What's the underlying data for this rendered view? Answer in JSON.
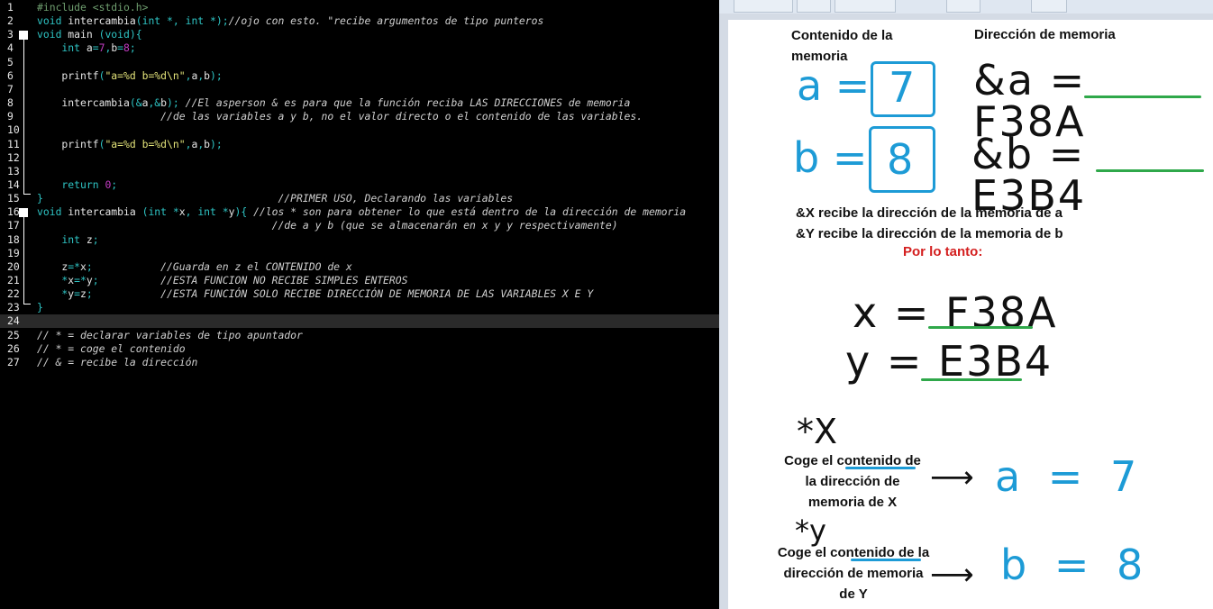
{
  "editor": {
    "lines": [
      {
        "n": "1",
        "tokens": [
          [
            "pp",
            "#include <stdio.h>"
          ]
        ]
      },
      {
        "n": "2",
        "tokens": [
          [
            "kw",
            "void "
          ],
          [
            "id",
            "intercambia"
          ],
          [
            "kw",
            "(int *, int *);"
          ],
          [
            "cm",
            "//ojo con esto. \"recibe argumentos de tipo punteros"
          ]
        ]
      },
      {
        "n": "3",
        "tokens": [
          [
            "kw",
            "void "
          ],
          [
            "id",
            "main "
          ],
          [
            "kw",
            "(void){"
          ]
        ]
      },
      {
        "n": "4",
        "tokens": [
          [
            "kw",
            "    int "
          ],
          [
            "id",
            "a"
          ],
          [
            "kw",
            "="
          ],
          [
            "num",
            "7"
          ],
          [
            "kw",
            ","
          ],
          [
            "id",
            "b"
          ],
          [
            "kw",
            "="
          ],
          [
            "num",
            "8"
          ],
          [
            "kw",
            ";"
          ]
        ]
      },
      {
        "n": "5",
        "tokens": []
      },
      {
        "n": "6",
        "tokens": [
          [
            "id",
            "    printf"
          ],
          [
            "kw",
            "("
          ],
          [
            "str",
            "\"a=%d b=%d\\n\""
          ],
          [
            "kw",
            ","
          ],
          [
            "id",
            "a"
          ],
          [
            "kw",
            ","
          ],
          [
            "id",
            "b"
          ],
          [
            "kw",
            ");"
          ]
        ]
      },
      {
        "n": "7",
        "tokens": []
      },
      {
        "n": "8",
        "tokens": [
          [
            "id",
            "    intercambia"
          ],
          [
            "kw",
            "(&"
          ],
          [
            "id",
            "a"
          ],
          [
            "kw",
            ",&"
          ],
          [
            "id",
            "b"
          ],
          [
            "kw",
            "); "
          ],
          [
            "cm",
            "//El asperson & es para que la función reciba LAS DIRECCIONES de memoria"
          ]
        ]
      },
      {
        "n": "9",
        "tokens": [
          [
            "cm",
            "                    //de las variables a y b, no el valor directo o el contenido de las variables."
          ]
        ]
      },
      {
        "n": "10",
        "tokens": []
      },
      {
        "n": "11",
        "tokens": [
          [
            "id",
            "    printf"
          ],
          [
            "kw",
            "("
          ],
          [
            "str",
            "\"a=%d b=%d\\n\""
          ],
          [
            "kw",
            ","
          ],
          [
            "id",
            "a"
          ],
          [
            "kw",
            ","
          ],
          [
            "id",
            "b"
          ],
          [
            "kw",
            ");"
          ]
        ]
      },
      {
        "n": "12",
        "tokens": []
      },
      {
        "n": "13",
        "tokens": []
      },
      {
        "n": "14",
        "tokens": [
          [
            "kw",
            "    return "
          ],
          [
            "num",
            "0"
          ],
          [
            "kw",
            ";"
          ]
        ]
      },
      {
        "n": "15",
        "tokens": [
          [
            "kw",
            "}"
          ],
          [
            "cm",
            "                                      //PRIMER USO, Declarando las variables"
          ]
        ]
      },
      {
        "n": "16",
        "tokens": [
          [
            "kw",
            "void "
          ],
          [
            "id",
            "intercambia "
          ],
          [
            "kw",
            "(int *"
          ],
          [
            "id",
            "x"
          ],
          [
            "kw",
            ", int *"
          ],
          [
            "id",
            "y"
          ],
          [
            "kw",
            "){ "
          ],
          [
            "cm",
            "//los * son para obtener lo que está dentro de la dirección de memoria"
          ]
        ]
      },
      {
        "n": "17",
        "tokens": [
          [
            "cm",
            "                                      //de a y b (que se almacenarán en x y y respectivamente)"
          ]
        ]
      },
      {
        "n": "18",
        "tokens": [
          [
            "kw",
            "    int "
          ],
          [
            "id",
            "z"
          ],
          [
            "kw",
            ";"
          ]
        ]
      },
      {
        "n": "19",
        "tokens": []
      },
      {
        "n": "20",
        "tokens": [
          [
            "id",
            "    z"
          ],
          [
            "kw",
            "=*"
          ],
          [
            "id",
            "x"
          ],
          [
            "kw",
            ";"
          ],
          [
            "cm",
            "           //Guarda en z el CONTENIDO de x"
          ]
        ]
      },
      {
        "n": "21",
        "tokens": [
          [
            "kw",
            "    *"
          ],
          [
            "id",
            "x"
          ],
          [
            "kw",
            "=*"
          ],
          [
            "id",
            "y"
          ],
          [
            "kw",
            ";"
          ],
          [
            "cm",
            "          //ESTA FUNCION NO RECIBE SIMPLES ENTEROS"
          ]
        ]
      },
      {
        "n": "22",
        "tokens": [
          [
            "kw",
            "    *"
          ],
          [
            "id",
            "y"
          ],
          [
            "kw",
            "="
          ],
          [
            "id",
            "z"
          ],
          [
            "kw",
            ";"
          ],
          [
            "cm",
            "           //ESTA FUNCIÓN SOLO RECIBE DIRECCIÓN DE MEMORIA DE LAS VARIABLES X E Y"
          ]
        ]
      },
      {
        "n": "23",
        "tokens": [
          [
            "kw",
            "}"
          ]
        ]
      },
      {
        "n": "24",
        "tokens": []
      },
      {
        "n": "25",
        "tokens": [
          [
            "cm",
            "// * = declarar variables de tipo apuntador"
          ]
        ]
      },
      {
        "n": "26",
        "tokens": [
          [
            "cm",
            "// * = coge el contenido"
          ]
        ]
      },
      {
        "n": "27",
        "tokens": [
          [
            "cm",
            "// & = recibe la dirección"
          ]
        ]
      }
    ]
  },
  "notes": {
    "heading_content": "Contenido de la memoria",
    "heading_address": "Dirección de memoria",
    "a_label": "a =",
    "a_value": "7",
    "b_label": "b =",
    "b_value": "8",
    "addr_a": "&a = F38A",
    "addr_b": "&b = E3B4",
    "x_receives": "&X recibe la dirección de la memoria de a",
    "y_receives": "&Y recibe la dirección de la memoria de b",
    "therefore": "Por lo tanto:",
    "x_eq": "x = F38A",
    "y_eq": "y = E3B4",
    "star_x": "*X",
    "star_x_desc": "Coge el contenido de la dirección de memoria de X",
    "star_x_result": "a = 7",
    "star_y": "*y",
    "star_y_desc": "Coge el contenido de la dirección de memoria de Y",
    "star_y_result": "b = 8",
    "arrow": "⟶"
  },
  "colors": {
    "handwriting_blue": "#1d9bd6",
    "underline_green": "#2fa84a",
    "highlight_red": "#d42020"
  }
}
